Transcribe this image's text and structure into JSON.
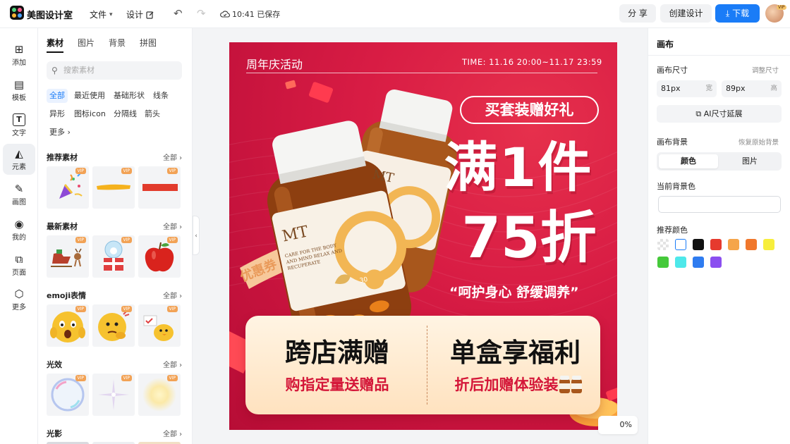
{
  "app": {
    "name": "美图设计室"
  },
  "topbar": {
    "file_label": "文件",
    "design_label": "设计",
    "saved_status": "10:41 已保存",
    "share_label": "分 享",
    "create_label": "创建设计",
    "download_label": "下载",
    "avatar_badge": "VIP"
  },
  "rail": {
    "items": [
      {
        "label": "添加",
        "icon": "plus-square-icon"
      },
      {
        "label": "模板",
        "icon": "template-icon"
      },
      {
        "label": "文字",
        "icon": "text-icon"
      },
      {
        "label": "元素",
        "icon": "shapes-icon"
      },
      {
        "label": "画图",
        "icon": "draw-icon"
      },
      {
        "label": "我的",
        "icon": "user-icon"
      },
      {
        "label": "页面",
        "icon": "page-add-icon"
      },
      {
        "label": "更多",
        "icon": "cube-icon"
      }
    ]
  },
  "panel": {
    "tabs": [
      "素材",
      "图片",
      "背景",
      "拼图"
    ],
    "search_placeholder": "搜索素材",
    "chips": [
      "全部",
      "最近使用",
      "基础形状",
      "线条",
      "异形",
      "图标icon",
      "分隔线",
      "箭头",
      "更多"
    ],
    "sections": [
      {
        "title": "推荐素材",
        "all": "全部"
      },
      {
        "title": "最新素材",
        "all": "全部"
      },
      {
        "title": "emoji表情",
        "all": "全部"
      },
      {
        "title": "光效",
        "all": "全部"
      },
      {
        "title": "光影",
        "all": "全部"
      }
    ],
    "vip_badge": "VIP"
  },
  "poster": {
    "top_title": "周年庆活动",
    "time": "TIME: 11.16 20:00~11.17 23:59",
    "pill": "买套装赠好礼",
    "headline_1": "满1件",
    "headline_2": "75折",
    "slogan": "“呵护身心 舒缓调养”",
    "bottle_brand": "MT",
    "bottle_text": "CARE FOR THE BODY AND MIND RELAX AND RECUPERATE",
    "bottle_number": "30",
    "coupon_text": "优惠券",
    "block_left_title": "跨店满赠",
    "block_left_sub": "购指定量送赠品",
    "block_right_title": "单盒享福利",
    "block_right_sub": "折后加赠体验装"
  },
  "zoom": "0%",
  "rpanel": {
    "title": "画布",
    "canvas_size_label": "画布尺寸",
    "adjust_size": "调整尺寸",
    "width_value": "81px",
    "width_unit": "宽",
    "height_value": "89px",
    "height_unit": "高",
    "ai_extend": "AI尺寸延展",
    "bg_label": "画布背景",
    "restore_bg": "恢复原始背景",
    "seg_color": "颜色",
    "seg_image": "图片",
    "current_bg_label": "当前背景色",
    "recommend_label": "推荐颜色",
    "swatches": [
      "transparent",
      "#ffffff",
      "#111111",
      "#e63a2e",
      "#f5a54a",
      "#f0772c",
      "#f7ee3c",
      "#45c93a",
      "#4ee8ea",
      "#2f7cf0",
      "#8b4ff0"
    ]
  },
  "colors": {
    "accent": "#1a7cf7",
    "poster_red": "#d81c44"
  }
}
